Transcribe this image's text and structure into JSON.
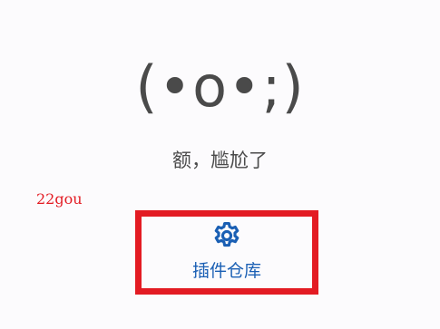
{
  "empty_state": {
    "emoticon": "(•o•;)",
    "message": "额，尴尬了"
  },
  "watermark": {
    "text": "22gou"
  },
  "plugin_store": {
    "icon": "gear-icon",
    "label": "插件仓库"
  },
  "colors": {
    "background": "#fcfbfd",
    "text": "#4a4a4a",
    "accent": "#1a5fb4",
    "highlight": "#e31b23"
  }
}
